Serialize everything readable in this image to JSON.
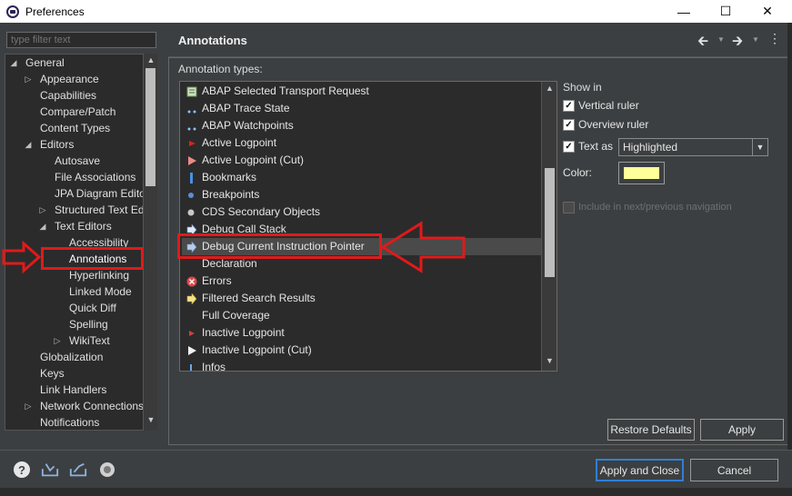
{
  "window": {
    "title": "Preferences"
  },
  "filter": {
    "placeholder": "type filter text"
  },
  "tree": {
    "items": [
      {
        "label": "General",
        "level": 0,
        "expander": "open"
      },
      {
        "label": "Appearance",
        "level": 1,
        "expander": "closed"
      },
      {
        "label": "Capabilities",
        "level": 1,
        "expander": "none"
      },
      {
        "label": "Compare/Patch",
        "level": 1,
        "expander": "none"
      },
      {
        "label": "Content Types",
        "level": 1,
        "expander": "none"
      },
      {
        "label": "Editors",
        "level": 1,
        "expander": "open"
      },
      {
        "label": "Autosave",
        "level": 2,
        "expander": "none"
      },
      {
        "label": "File Associations",
        "level": 2,
        "expander": "none"
      },
      {
        "label": "JPA Diagram Edito",
        "level": 2,
        "expander": "none"
      },
      {
        "label": "Structured Text Ed",
        "level": 2,
        "expander": "closed"
      },
      {
        "label": "Text Editors",
        "level": 2,
        "expander": "open"
      },
      {
        "label": "Accessibility",
        "level": 3,
        "expander": "none"
      },
      {
        "label": "Annotations",
        "level": 3,
        "expander": "none",
        "selected": true
      },
      {
        "label": "Hyperlinking",
        "level": 3,
        "expander": "none"
      },
      {
        "label": "Linked Mode",
        "level": 3,
        "expander": "none"
      },
      {
        "label": "Quick Diff",
        "level": 3,
        "expander": "none"
      },
      {
        "label": "Spelling",
        "level": 3,
        "expander": "none"
      },
      {
        "label": "WikiText",
        "level": 3,
        "expander": "closed"
      },
      {
        "label": "Globalization",
        "level": 1,
        "expander": "none"
      },
      {
        "label": "Keys",
        "level": 1,
        "expander": "none"
      },
      {
        "label": "Link Handlers",
        "level": 1,
        "expander": "none"
      },
      {
        "label": "Network Connections",
        "level": 1,
        "expander": "closed"
      },
      {
        "label": "Notifications",
        "level": 1,
        "expander": "none"
      }
    ]
  },
  "page": {
    "title": "Annotations"
  },
  "annotation_types": {
    "label": "Annotation types:",
    "items": [
      {
        "label": "ABAP Selected Transport Request",
        "icon": "transport-icon"
      },
      {
        "label": "ABAP Trace State",
        "icon": "dots-icon"
      },
      {
        "label": "ABAP Watchpoints",
        "icon": "dots-icon"
      },
      {
        "label": "Active Logpoint",
        "icon": "red-triangle-icon"
      },
      {
        "label": "Active Logpoint (Cut)",
        "icon": "pink-triangle-icon"
      },
      {
        "label": "Bookmarks",
        "icon": "bookmark-icon"
      },
      {
        "label": "Breakpoints",
        "icon": "blue-dot-icon"
      },
      {
        "label": "CDS Secondary Objects",
        "icon": "gray-dot-icon"
      },
      {
        "label": "Debug Call Stack",
        "icon": "call-stack-arrow-icon"
      },
      {
        "label": "Debug Current Instruction Pointer",
        "icon": "instruction-pointer-icon",
        "selected": true
      },
      {
        "label": "Declaration",
        "icon": "none"
      },
      {
        "label": "Errors",
        "icon": "error-icon"
      },
      {
        "label": "Filtered Search Results",
        "icon": "search-result-arrow-icon"
      },
      {
        "label": "Full Coverage",
        "icon": "none"
      },
      {
        "label": "Inactive Logpoint",
        "icon": "red-small-triangle-icon"
      },
      {
        "label": "Inactive Logpoint (Cut)",
        "icon": "white-triangle-icon"
      },
      {
        "label": "Infos",
        "icon": "info-icon"
      }
    ]
  },
  "options": {
    "show_in_label": "Show in",
    "vertical_ruler": {
      "label": "Vertical ruler",
      "checked": true
    },
    "overview_ruler": {
      "label": "Overview ruler",
      "checked": true
    },
    "text_as": {
      "label": "Text as",
      "checked": true,
      "value": "Highlighted"
    },
    "color_label": "Color:",
    "color_value": "#ffff99",
    "include_nav": {
      "label": "Include in next/previous navigation",
      "checked": false,
      "enabled": false
    }
  },
  "buttons": {
    "restore_defaults": "Restore Defaults",
    "apply": "Apply",
    "apply_and_close": "Apply and Close",
    "cancel": "Cancel"
  },
  "colors": {
    "annotation_red": "#e01a1a",
    "default_button_border": "#2f7fd6"
  }
}
